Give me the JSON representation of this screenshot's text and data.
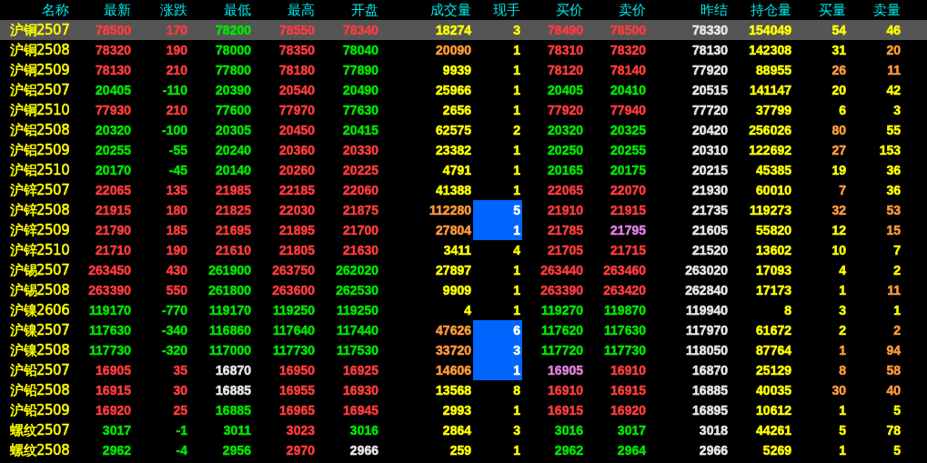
{
  "columns": [
    "名称",
    "最新",
    "涨跌",
    "最低",
    "最高",
    "开盘",
    "成交量",
    "现手",
    "买价",
    "卖价",
    "昨结",
    "持仓量",
    "买量",
    "卖量"
  ],
  "rows": [
    {
      "name": "沪铜2507",
      "selected": true,
      "hand_highlighted": false,
      "cells": [
        {
          "text": "78500",
          "color": "#ff3c3c"
        },
        {
          "text": "170",
          "color": "#ff3c3c"
        },
        {
          "text": "78200",
          "color": "#00e600"
        },
        {
          "text": "78550",
          "color": "#ff3c3c"
        },
        {
          "text": "78340",
          "color": "#ff3c3c"
        },
        {
          "text": "18274",
          "color": "#ffff00"
        },
        {
          "text": "3",
          "color": "#ffff00"
        },
        {
          "text": "78490",
          "color": "#ff3c3c"
        },
        {
          "text": "78500",
          "color": "#ff3c3c"
        },
        {
          "text": "78330",
          "color": "#e6e6e6"
        },
        {
          "text": "154049",
          "color": "#ffff00"
        },
        {
          "text": "54",
          "color": "#ffff00"
        },
        {
          "text": "46",
          "color": "#ffff00"
        }
      ]
    },
    {
      "name": "沪铜2508",
      "selected": false,
      "hand_highlighted": false,
      "cells": [
        {
          "text": "78320",
          "color": "#ff3c3c"
        },
        {
          "text": "190",
          "color": "#ff3c3c"
        },
        {
          "text": "78000",
          "color": "#00e600"
        },
        {
          "text": "78350",
          "color": "#ff3c3c"
        },
        {
          "text": "78040",
          "color": "#00e600"
        },
        {
          "text": "20090",
          "color": "#ff9a3c"
        },
        {
          "text": "1",
          "color": "#ffff00"
        },
        {
          "text": "78310",
          "color": "#ff3c3c"
        },
        {
          "text": "78320",
          "color": "#ff3c3c"
        },
        {
          "text": "78130",
          "color": "#e6e6e6"
        },
        {
          "text": "142308",
          "color": "#ffff00"
        },
        {
          "text": "31",
          "color": "#ffff00"
        },
        {
          "text": "20",
          "color": "#ff9a3c"
        }
      ]
    },
    {
      "name": "沪铜2509",
      "selected": false,
      "hand_highlighted": false,
      "cells": [
        {
          "text": "78130",
          "color": "#ff3c3c"
        },
        {
          "text": "210",
          "color": "#ff3c3c"
        },
        {
          "text": "77800",
          "color": "#00e600"
        },
        {
          "text": "78180",
          "color": "#ff3c3c"
        },
        {
          "text": "77890",
          "color": "#00e600"
        },
        {
          "text": "9939",
          "color": "#ffff00"
        },
        {
          "text": "1",
          "color": "#ffff00"
        },
        {
          "text": "78120",
          "color": "#ff3c3c"
        },
        {
          "text": "78140",
          "color": "#ff3c3c"
        },
        {
          "text": "77920",
          "color": "#e6e6e6"
        },
        {
          "text": "88955",
          "color": "#ffff00"
        },
        {
          "text": "26",
          "color": "#ff9a3c"
        },
        {
          "text": "11",
          "color": "#ff9a3c"
        }
      ]
    },
    {
      "name": "沪铝2507",
      "selected": false,
      "hand_highlighted": false,
      "cells": [
        {
          "text": "20405",
          "color": "#00e600"
        },
        {
          "text": "-110",
          "color": "#00e600"
        },
        {
          "text": "20390",
          "color": "#00e600"
        },
        {
          "text": "20540",
          "color": "#ff3c3c"
        },
        {
          "text": "20490",
          "color": "#00e600"
        },
        {
          "text": "25966",
          "color": "#ffff00"
        },
        {
          "text": "1",
          "color": "#ffff00"
        },
        {
          "text": "20405",
          "color": "#00e600"
        },
        {
          "text": "20410",
          "color": "#00e600"
        },
        {
          "text": "20515",
          "color": "#e6e6e6"
        },
        {
          "text": "141147",
          "color": "#ffff00"
        },
        {
          "text": "20",
          "color": "#ffff00"
        },
        {
          "text": "42",
          "color": "#ffff00"
        }
      ]
    },
    {
      "name": "沪铜2510",
      "selected": false,
      "hand_highlighted": false,
      "cells": [
        {
          "text": "77930",
          "color": "#ff3c3c"
        },
        {
          "text": "210",
          "color": "#ff3c3c"
        },
        {
          "text": "77600",
          "color": "#00e600"
        },
        {
          "text": "77970",
          "color": "#ff3c3c"
        },
        {
          "text": "77630",
          "color": "#00e600"
        },
        {
          "text": "2656",
          "color": "#ffff00"
        },
        {
          "text": "1",
          "color": "#ffff00"
        },
        {
          "text": "77920",
          "color": "#ff3c3c"
        },
        {
          "text": "77940",
          "color": "#ff3c3c"
        },
        {
          "text": "77720",
          "color": "#e6e6e6"
        },
        {
          "text": "37799",
          "color": "#ffff00"
        },
        {
          "text": "6",
          "color": "#ffff00"
        },
        {
          "text": "3",
          "color": "#ffff00"
        }
      ]
    },
    {
      "name": "沪铝2508",
      "selected": false,
      "hand_highlighted": false,
      "cells": [
        {
          "text": "20320",
          "color": "#00e600"
        },
        {
          "text": "-100",
          "color": "#00e600"
        },
        {
          "text": "20305",
          "color": "#00e600"
        },
        {
          "text": "20450",
          "color": "#ff3c3c"
        },
        {
          "text": "20415",
          "color": "#00e600"
        },
        {
          "text": "62575",
          "color": "#ffff00"
        },
        {
          "text": "2",
          "color": "#ffff00"
        },
        {
          "text": "20320",
          "color": "#00e600"
        },
        {
          "text": "20325",
          "color": "#00e600"
        },
        {
          "text": "20420",
          "color": "#e6e6e6"
        },
        {
          "text": "256026",
          "color": "#ffff00"
        },
        {
          "text": "80",
          "color": "#ff9a3c"
        },
        {
          "text": "55",
          "color": "#ffff00"
        }
      ]
    },
    {
      "name": "沪铝2509",
      "selected": false,
      "hand_highlighted": false,
      "cells": [
        {
          "text": "20255",
          "color": "#00e600"
        },
        {
          "text": "-55",
          "color": "#00e600"
        },
        {
          "text": "20240",
          "color": "#00e600"
        },
        {
          "text": "20360",
          "color": "#ff3c3c"
        },
        {
          "text": "20330",
          "color": "#ff3c3c"
        },
        {
          "text": "23382",
          "color": "#ffff00"
        },
        {
          "text": "1",
          "color": "#ffff00"
        },
        {
          "text": "20250",
          "color": "#00e600"
        },
        {
          "text": "20255",
          "color": "#00e600"
        },
        {
          "text": "20310",
          "color": "#e6e6e6"
        },
        {
          "text": "122692",
          "color": "#ffff00"
        },
        {
          "text": "27",
          "color": "#ff9a3c"
        },
        {
          "text": "153",
          "color": "#ffff00"
        }
      ]
    },
    {
      "name": "沪铝2510",
      "selected": false,
      "hand_highlighted": false,
      "cells": [
        {
          "text": "20170",
          "color": "#00e600"
        },
        {
          "text": "-45",
          "color": "#00e600"
        },
        {
          "text": "20140",
          "color": "#00e600"
        },
        {
          "text": "20260",
          "color": "#ff3c3c"
        },
        {
          "text": "20225",
          "color": "#ff3c3c"
        },
        {
          "text": "4791",
          "color": "#ffff00"
        },
        {
          "text": "1",
          "color": "#ffff00"
        },
        {
          "text": "20165",
          "color": "#00e600"
        },
        {
          "text": "20175",
          "color": "#00e600"
        },
        {
          "text": "20215",
          "color": "#e6e6e6"
        },
        {
          "text": "45385",
          "color": "#ffff00"
        },
        {
          "text": "19",
          "color": "#ffff00"
        },
        {
          "text": "36",
          "color": "#ffff00"
        }
      ]
    },
    {
      "name": "沪锌2507",
      "selected": false,
      "hand_highlighted": false,
      "cells": [
        {
          "text": "22065",
          "color": "#ff3c3c"
        },
        {
          "text": "135",
          "color": "#ff3c3c"
        },
        {
          "text": "21985",
          "color": "#ff3c3c"
        },
        {
          "text": "22185",
          "color": "#ff3c3c"
        },
        {
          "text": "22060",
          "color": "#ff3c3c"
        },
        {
          "text": "41388",
          "color": "#ffff00"
        },
        {
          "text": "1",
          "color": "#ffff00"
        },
        {
          "text": "22065",
          "color": "#ff3c3c"
        },
        {
          "text": "22070",
          "color": "#ff3c3c"
        },
        {
          "text": "21930",
          "color": "#e6e6e6"
        },
        {
          "text": "60010",
          "color": "#ffff00"
        },
        {
          "text": "7",
          "color": "#ff9a3c"
        },
        {
          "text": "36",
          "color": "#ffff00"
        }
      ]
    },
    {
      "name": "沪锌2508",
      "selected": false,
      "hand_highlighted": true,
      "cells": [
        {
          "text": "21915",
          "color": "#ff3c3c"
        },
        {
          "text": "180",
          "color": "#ff3c3c"
        },
        {
          "text": "21825",
          "color": "#ff3c3c"
        },
        {
          "text": "22030",
          "color": "#ff3c3c"
        },
        {
          "text": "21875",
          "color": "#ff3c3c"
        },
        {
          "text": "112280",
          "color": "#ff9a3c"
        },
        {
          "text": "5",
          "color": "#ffffff"
        },
        {
          "text": "21910",
          "color": "#ff3c3c"
        },
        {
          "text": "21915",
          "color": "#ff3c3c"
        },
        {
          "text": "21735",
          "color": "#e6e6e6"
        },
        {
          "text": "119273",
          "color": "#ffff00"
        },
        {
          "text": "32",
          "color": "#ff9a3c"
        },
        {
          "text": "53",
          "color": "#ff9a3c"
        }
      ]
    },
    {
      "name": "沪锌2509",
      "selected": false,
      "hand_highlighted": true,
      "cells": [
        {
          "text": "21790",
          "color": "#ff3c3c"
        },
        {
          "text": "185",
          "color": "#ff3c3c"
        },
        {
          "text": "21695",
          "color": "#ff3c3c"
        },
        {
          "text": "21895",
          "color": "#ff3c3c"
        },
        {
          "text": "21700",
          "color": "#ff3c3c"
        },
        {
          "text": "27804",
          "color": "#ff9a3c"
        },
        {
          "text": "1",
          "color": "#ffffff"
        },
        {
          "text": "21785",
          "color": "#ff3c3c"
        },
        {
          "text": "21795",
          "color": "#e080e0"
        },
        {
          "text": "21605",
          "color": "#e6e6e6"
        },
        {
          "text": "55820",
          "color": "#ffff00"
        },
        {
          "text": "12",
          "color": "#ffff00"
        },
        {
          "text": "15",
          "color": "#ff9a3c"
        }
      ]
    },
    {
      "name": "沪锌2510",
      "selected": false,
      "hand_highlighted": false,
      "cells": [
        {
          "text": "21710",
          "color": "#ff3c3c"
        },
        {
          "text": "190",
          "color": "#ff3c3c"
        },
        {
          "text": "21610",
          "color": "#ff3c3c"
        },
        {
          "text": "21805",
          "color": "#ff3c3c"
        },
        {
          "text": "21630",
          "color": "#ff3c3c"
        },
        {
          "text": "3411",
          "color": "#ffff00"
        },
        {
          "text": "4",
          "color": "#ffff00"
        },
        {
          "text": "21705",
          "color": "#ff3c3c"
        },
        {
          "text": "21715",
          "color": "#ff3c3c"
        },
        {
          "text": "21520",
          "color": "#e6e6e6"
        },
        {
          "text": "13602",
          "color": "#ffff00"
        },
        {
          "text": "10",
          "color": "#ffff00"
        },
        {
          "text": "7",
          "color": "#ffff00"
        }
      ]
    },
    {
      "name": "沪锡2507",
      "selected": false,
      "hand_highlighted": false,
      "cells": [
        {
          "text": "263450",
          "color": "#ff3c3c"
        },
        {
          "text": "430",
          "color": "#ff3c3c"
        },
        {
          "text": "261900",
          "color": "#00e600"
        },
        {
          "text": "263750",
          "color": "#ff3c3c"
        },
        {
          "text": "262020",
          "color": "#00e600"
        },
        {
          "text": "27897",
          "color": "#ffff00"
        },
        {
          "text": "1",
          "color": "#ffff00"
        },
        {
          "text": "263440",
          "color": "#ff3c3c"
        },
        {
          "text": "263460",
          "color": "#ff3c3c"
        },
        {
          "text": "263020",
          "color": "#e6e6e6"
        },
        {
          "text": "17093",
          "color": "#ffff00"
        },
        {
          "text": "4",
          "color": "#ffff00"
        },
        {
          "text": "2",
          "color": "#ffff00"
        }
      ]
    },
    {
      "name": "沪锡2508",
      "selected": false,
      "hand_highlighted": false,
      "cells": [
        {
          "text": "263390",
          "color": "#ff3c3c"
        },
        {
          "text": "550",
          "color": "#ff3c3c"
        },
        {
          "text": "261800",
          "color": "#00e600"
        },
        {
          "text": "263600",
          "color": "#ff3c3c"
        },
        {
          "text": "262530",
          "color": "#00e600"
        },
        {
          "text": "9909",
          "color": "#ffff00"
        },
        {
          "text": "1",
          "color": "#ffff00"
        },
        {
          "text": "263390",
          "color": "#ff3c3c"
        },
        {
          "text": "263420",
          "color": "#ff3c3c"
        },
        {
          "text": "262840",
          "color": "#e6e6e6"
        },
        {
          "text": "17173",
          "color": "#ffff00"
        },
        {
          "text": "1",
          "color": "#ffff00"
        },
        {
          "text": "11",
          "color": "#ff9a3c"
        }
      ]
    },
    {
      "name": "沪镍2606",
      "selected": false,
      "hand_highlighted": false,
      "cells": [
        {
          "text": "119170",
          "color": "#00e600"
        },
        {
          "text": "-770",
          "color": "#00e600"
        },
        {
          "text": "119170",
          "color": "#00e600"
        },
        {
          "text": "119250",
          "color": "#00e600"
        },
        {
          "text": "119250",
          "color": "#00e600"
        },
        {
          "text": "4",
          "color": "#ffff00"
        },
        {
          "text": "1",
          "color": "#ffff00"
        },
        {
          "text": "119270",
          "color": "#00e600"
        },
        {
          "text": "119870",
          "color": "#00e600"
        },
        {
          "text": "119940",
          "color": "#e6e6e6"
        },
        {
          "text": "8",
          "color": "#ffff00"
        },
        {
          "text": "3",
          "color": "#ffff00"
        },
        {
          "text": "1",
          "color": "#ffff00"
        }
      ]
    },
    {
      "name": "沪镍2507",
      "selected": false,
      "hand_highlighted": true,
      "cells": [
        {
          "text": "117630",
          "color": "#00e600"
        },
        {
          "text": "-340",
          "color": "#00e600"
        },
        {
          "text": "116860",
          "color": "#00e600"
        },
        {
          "text": "117640",
          "color": "#00e600"
        },
        {
          "text": "117440",
          "color": "#00e600"
        },
        {
          "text": "47626",
          "color": "#ff9a3c"
        },
        {
          "text": "6",
          "color": "#ffffff"
        },
        {
          "text": "117620",
          "color": "#00e600"
        },
        {
          "text": "117630",
          "color": "#00e600"
        },
        {
          "text": "117970",
          "color": "#e6e6e6"
        },
        {
          "text": "61672",
          "color": "#ffff00"
        },
        {
          "text": "2",
          "color": "#ffff00"
        },
        {
          "text": "2",
          "color": "#ff9a3c"
        }
      ]
    },
    {
      "name": "沪镍2508",
      "selected": false,
      "hand_highlighted": true,
      "cells": [
        {
          "text": "117730",
          "color": "#00e600"
        },
        {
          "text": "-320",
          "color": "#00e600"
        },
        {
          "text": "117000",
          "color": "#00e600"
        },
        {
          "text": "117730",
          "color": "#00e600"
        },
        {
          "text": "117530",
          "color": "#00e600"
        },
        {
          "text": "33720",
          "color": "#ff9a3c"
        },
        {
          "text": "3",
          "color": "#ffffff"
        },
        {
          "text": "117720",
          "color": "#00e600"
        },
        {
          "text": "117730",
          "color": "#00e600"
        },
        {
          "text": "118050",
          "color": "#e6e6e6"
        },
        {
          "text": "87764",
          "color": "#ffff00"
        },
        {
          "text": "1",
          "color": "#ff9a3c"
        },
        {
          "text": "94",
          "color": "#ff9a3c"
        }
      ]
    },
    {
      "name": "沪铅2507",
      "selected": false,
      "hand_highlighted": true,
      "cells": [
        {
          "text": "16905",
          "color": "#ff3c3c"
        },
        {
          "text": "35",
          "color": "#ff3c3c"
        },
        {
          "text": "16870",
          "color": "#e6e6e6"
        },
        {
          "text": "16950",
          "color": "#ff3c3c"
        },
        {
          "text": "16925",
          "color": "#ff3c3c"
        },
        {
          "text": "14606",
          "color": "#ff9a3c"
        },
        {
          "text": "1",
          "color": "#ffffff"
        },
        {
          "text": "16905",
          "color": "#e080e0"
        },
        {
          "text": "16910",
          "color": "#ff3c3c"
        },
        {
          "text": "16870",
          "color": "#e6e6e6"
        },
        {
          "text": "25129",
          "color": "#ffff00"
        },
        {
          "text": "8",
          "color": "#ff9a3c"
        },
        {
          "text": "58",
          "color": "#ff9a3c"
        }
      ]
    },
    {
      "name": "沪铅2508",
      "selected": false,
      "hand_highlighted": false,
      "cells": [
        {
          "text": "16915",
          "color": "#ff3c3c"
        },
        {
          "text": "30",
          "color": "#ff3c3c"
        },
        {
          "text": "16885",
          "color": "#e6e6e6"
        },
        {
          "text": "16955",
          "color": "#ff3c3c"
        },
        {
          "text": "16930",
          "color": "#ff3c3c"
        },
        {
          "text": "13568",
          "color": "#ffff00"
        },
        {
          "text": "8",
          "color": "#ffff00"
        },
        {
          "text": "16910",
          "color": "#ff3c3c"
        },
        {
          "text": "16915",
          "color": "#ff3c3c"
        },
        {
          "text": "16885",
          "color": "#e6e6e6"
        },
        {
          "text": "40035",
          "color": "#ffff00"
        },
        {
          "text": "30",
          "color": "#ff9a3c"
        },
        {
          "text": "40",
          "color": "#ff9a3c"
        }
      ]
    },
    {
      "name": "沪铅2509",
      "selected": false,
      "hand_highlighted": false,
      "cells": [
        {
          "text": "16920",
          "color": "#ff3c3c"
        },
        {
          "text": "25",
          "color": "#ff3c3c"
        },
        {
          "text": "16885",
          "color": "#00e600"
        },
        {
          "text": "16965",
          "color": "#ff3c3c"
        },
        {
          "text": "16945",
          "color": "#ff3c3c"
        },
        {
          "text": "2993",
          "color": "#ffff00"
        },
        {
          "text": "1",
          "color": "#ffff00"
        },
        {
          "text": "16915",
          "color": "#ff3c3c"
        },
        {
          "text": "16920",
          "color": "#ff3c3c"
        },
        {
          "text": "16895",
          "color": "#e6e6e6"
        },
        {
          "text": "10612",
          "color": "#ffff00"
        },
        {
          "text": "1",
          "color": "#ffff00"
        },
        {
          "text": "5",
          "color": "#ffff00"
        }
      ]
    },
    {
      "name": "螺纹2507",
      "selected": false,
      "hand_highlighted": false,
      "cells": [
        {
          "text": "3017",
          "color": "#00e600"
        },
        {
          "text": "-1",
          "color": "#00e600"
        },
        {
          "text": "3011",
          "color": "#00e600"
        },
        {
          "text": "3023",
          "color": "#ff3c3c"
        },
        {
          "text": "3016",
          "color": "#00e600"
        },
        {
          "text": "2864",
          "color": "#ffff00"
        },
        {
          "text": "3",
          "color": "#ffff00"
        },
        {
          "text": "3016",
          "color": "#00e600"
        },
        {
          "text": "3017",
          "color": "#00e600"
        },
        {
          "text": "3018",
          "color": "#e6e6e6"
        },
        {
          "text": "44261",
          "color": "#ffff00"
        },
        {
          "text": "5",
          "color": "#ffff00"
        },
        {
          "text": "78",
          "color": "#ffff00"
        }
      ]
    },
    {
      "name": "螺纹2508",
      "selected": false,
      "hand_highlighted": false,
      "cells": [
        {
          "text": "2962",
          "color": "#00e600"
        },
        {
          "text": "-4",
          "color": "#00e600"
        },
        {
          "text": "2956",
          "color": "#00e600"
        },
        {
          "text": "2970",
          "color": "#ff3c3c"
        },
        {
          "text": "2966",
          "color": "#e6e6e6"
        },
        {
          "text": "259",
          "color": "#ffff00"
        },
        {
          "text": "1",
          "color": "#ffff00"
        },
        {
          "text": "2962",
          "color": "#00e600"
        },
        {
          "text": "2964",
          "color": "#00e600"
        },
        {
          "text": "2966",
          "color": "#e6e6e6"
        },
        {
          "text": "5269",
          "color": "#ffff00"
        },
        {
          "text": "1",
          "color": "#ffff00"
        },
        {
          "text": "5",
          "color": "#ffff00"
        }
      ]
    }
  ]
}
